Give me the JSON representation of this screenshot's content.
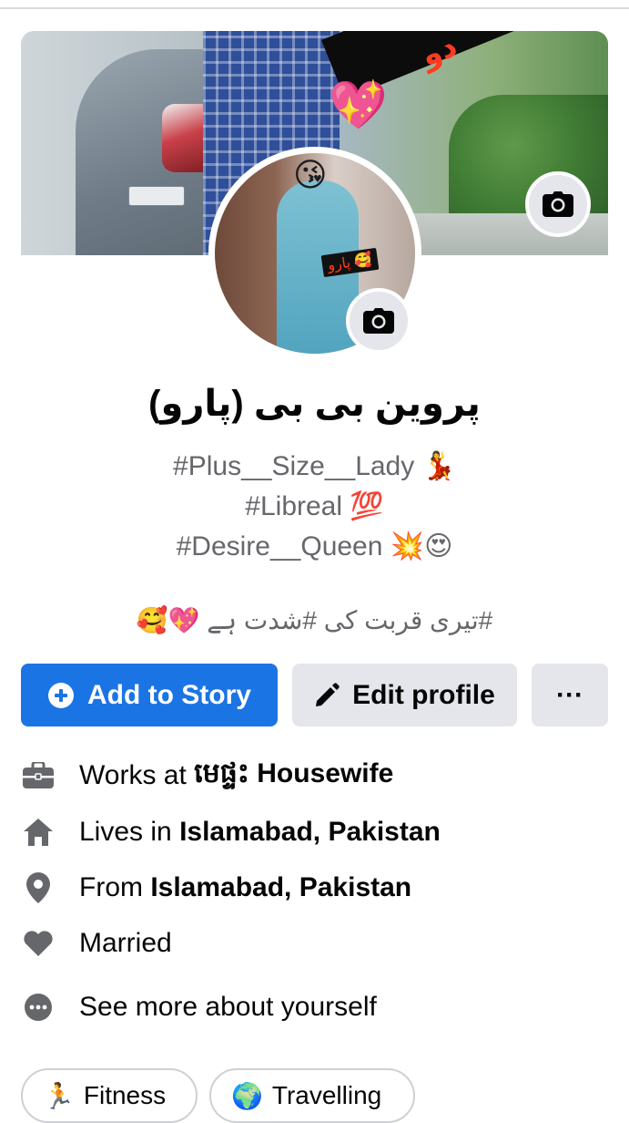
{
  "profile": {
    "name": "پروین بی بی (پارو)",
    "bio_lines": [
      "#Plus__Size__Lady 💃",
      "#Libreal 💯",
      "#Desire__Queen 💥😍"
    ],
    "tagline": "🥰💖 تیری قربت کی #شدت ہے#",
    "cover_sticker_text": "دو",
    "avatar_sticker_text": "پارو 🥰"
  },
  "actions": {
    "add_story_label": "Add to Story",
    "edit_profile_label": "Edit profile",
    "more_label": "···"
  },
  "details": {
    "work_prefix": "Works at ",
    "work_value": "មេផ្ទះ Housewife",
    "lives_prefix": "Lives in ",
    "lives_value": "Islamabad, Pakistan",
    "from_prefix": "From ",
    "from_value": "Islamabad, Pakistan",
    "relationship": "Married",
    "see_more": "See more about yourself"
  },
  "hobbies": [
    {
      "emoji": "🏃",
      "label": "Fitness"
    },
    {
      "emoji": "🌍",
      "label": "Travelling"
    }
  ],
  "colors": {
    "primary": "#1b74e4",
    "secondary_button": "#e4e6eb",
    "muted_text": "#65676b"
  }
}
